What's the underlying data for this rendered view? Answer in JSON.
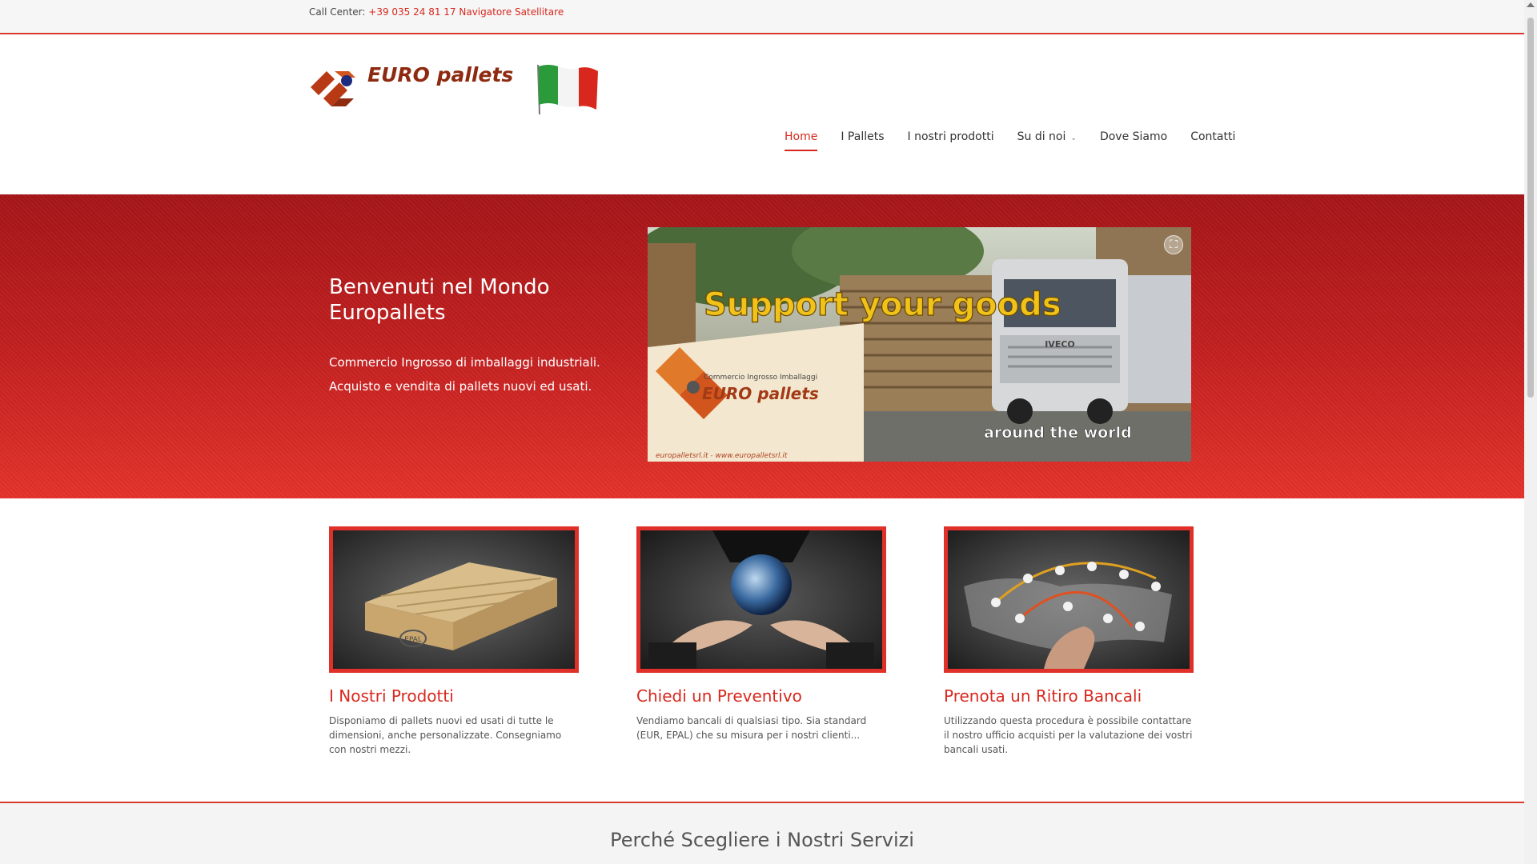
{
  "topbar": {
    "label": "Call Center:",
    "phone": "+39 035 24 81 17 Navigatore Satellitare"
  },
  "header": {
    "logo_text": "EURO pallets",
    "nav": [
      {
        "label": "Home",
        "active": true
      },
      {
        "label": "I Pallets"
      },
      {
        "label": "I nostri prodotti"
      },
      {
        "label": "Su di noi",
        "has_dropdown": true
      },
      {
        "label": "Dove Siamo"
      },
      {
        "label": "Contatti"
      }
    ]
  },
  "hero": {
    "title": "Benvenuti nel Mondo Europallets",
    "subtitle_line1": "Commercio Ingrosso di imballaggi industriali.",
    "subtitle_line2": "Acquisto e vendita di pallets nuovi ed usati.",
    "image": {
      "headline": "Support your goods",
      "tagline": "around the world",
      "sign_small": "Commercio Ingrosso Imballaggi",
      "sign_brand": "EURO pallets",
      "sign_url": "europalletsrl.it - www.europalletsrl.it",
      "truck_brand": "IVECO"
    }
  },
  "features": [
    {
      "title": "I Nostri Prodotti",
      "text": "Disponiamo di pallets nuovi ed usati di tutte le dimensioni, anche personalizzate. Consegniamo con nostri mezzi.",
      "stamp": "EPAL"
    },
    {
      "title": "Chiedi un Preventivo",
      "text": "Vendiamo bancali di qualsiasi tipo. Sia standard (EUR, EPAL) che su misura per i nostri clienti..."
    },
    {
      "title": "Prenota un Ritiro Bancali",
      "text": "Utilizzando questa procedura è possibile contattare il nostro ufficio acquisti per la valutazione dei vostri bancali usati."
    }
  ],
  "section": {
    "title": "Perché Scegliere i Nostri Servizi"
  },
  "colors": {
    "accent": "#d8281e",
    "hero_top": "#a51518",
    "hero_bottom": "#e4322a",
    "logo": "#8e2a10"
  }
}
